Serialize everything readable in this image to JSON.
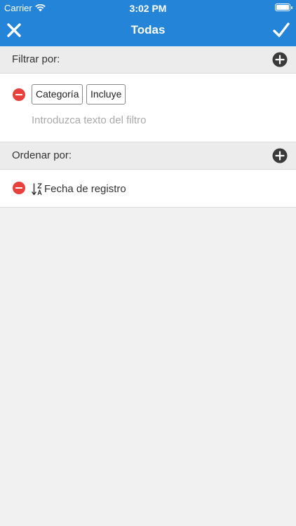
{
  "status_bar": {
    "carrier": "Carrier",
    "time": "3:02 PM",
    "battery_level": 1.0
  },
  "nav": {
    "title": "Todas",
    "close_icon": "close-icon",
    "done_icon": "checkmark-icon"
  },
  "filter": {
    "header": "Filtrar por:",
    "add_icon": "plus-circle-icon",
    "rows": [
      {
        "field": "Categoría",
        "operator": "Incluye",
        "placeholder": "Introduzca texto del filtro"
      }
    ]
  },
  "sort": {
    "header": "Ordenar por:",
    "add_icon": "plus-circle-icon",
    "rows": [
      {
        "icon": "sort-descending-icon",
        "label": "Fecha de registro"
      }
    ]
  },
  "colors": {
    "accent": "#2384d8",
    "danger": "#e8403d",
    "background": "#f1f1f1"
  }
}
